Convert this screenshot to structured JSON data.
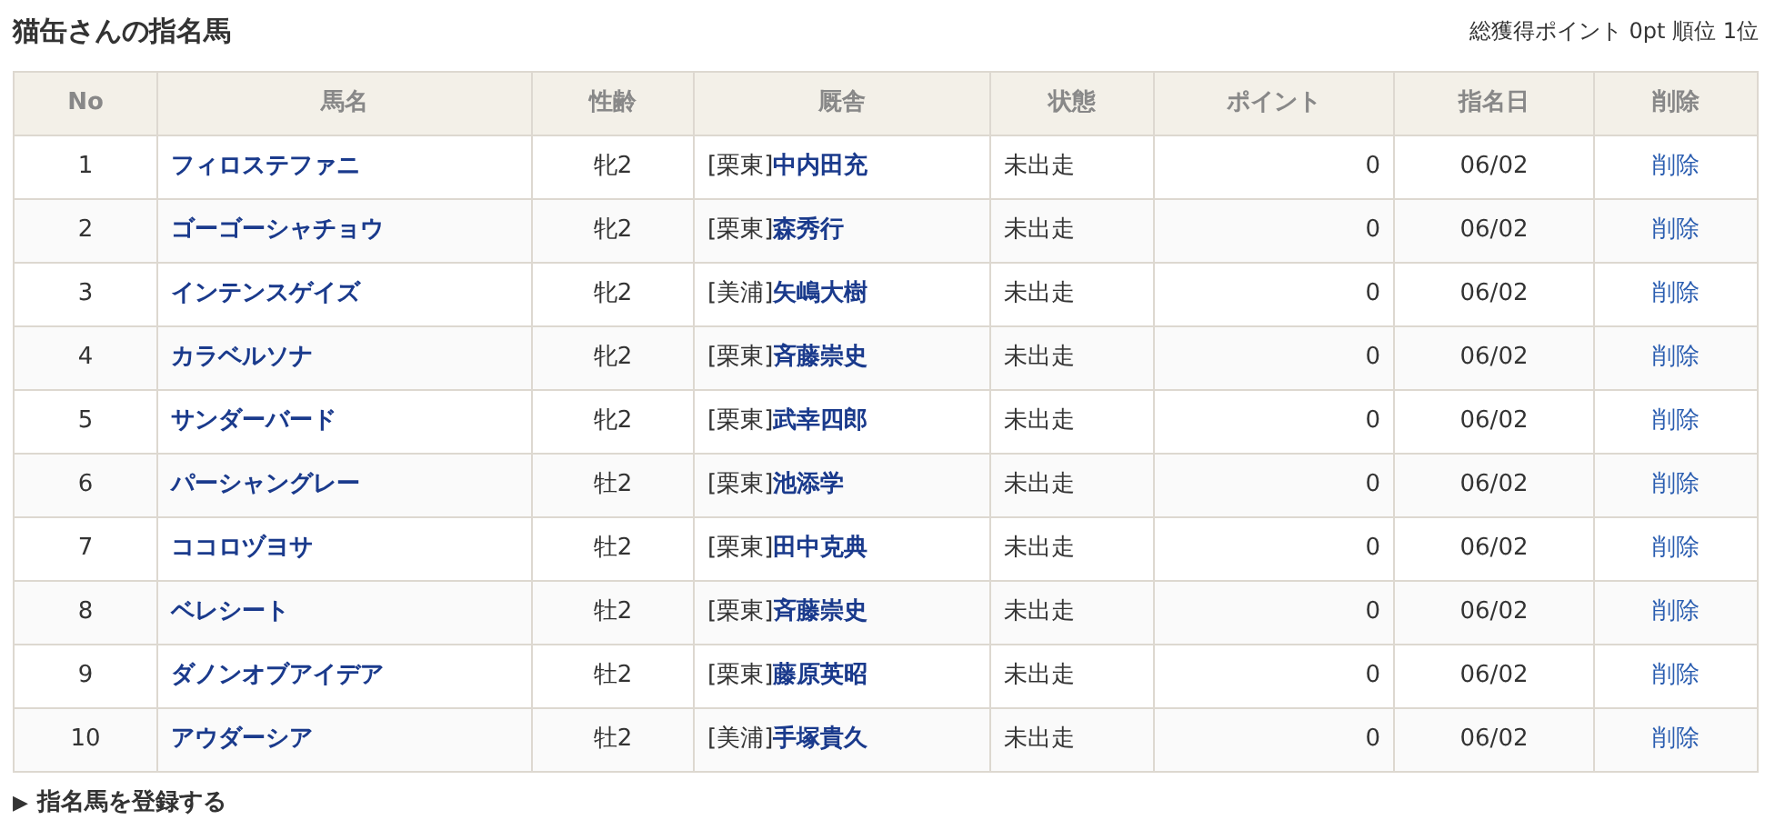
{
  "title": "猫缶さんの指名馬",
  "summary": "総獲得ポイント 0pt 順位 1位",
  "table": {
    "columns": [
      "No",
      "馬名",
      "性齢",
      "厩舎",
      "状態",
      "ポイント",
      "指名日",
      "削除"
    ],
    "rows": [
      {
        "no": "1",
        "horse": "フィロステファニ",
        "sex_age": "牝2",
        "stable": "[栗東]",
        "trainer": "中内田充",
        "status": "未出走",
        "points": "0",
        "date": "06/02",
        "delete": "削除"
      },
      {
        "no": "2",
        "horse": "ゴーゴーシャチョウ",
        "sex_age": "牝2",
        "stable": "[栗東]",
        "trainer": "森秀行",
        "status": "未出走",
        "points": "0",
        "date": "06/02",
        "delete": "削除"
      },
      {
        "no": "3",
        "horse": "インテンスゲイズ",
        "sex_age": "牝2",
        "stable": "[美浦]",
        "trainer": "矢嶋大樹",
        "status": "未出走",
        "points": "0",
        "date": "06/02",
        "delete": "削除"
      },
      {
        "no": "4",
        "horse": "カラベルソナ",
        "sex_age": "牝2",
        "stable": "[栗東]",
        "trainer": "斉藤崇史",
        "status": "未出走",
        "points": "0",
        "date": "06/02",
        "delete": "削除"
      },
      {
        "no": "5",
        "horse": "サンダーバード",
        "sex_age": "牝2",
        "stable": "[栗東]",
        "trainer": "武幸四郎",
        "status": "未出走",
        "points": "0",
        "date": "06/02",
        "delete": "削除"
      },
      {
        "no": "6",
        "horse": "パーシャングレー",
        "sex_age": "牡2",
        "stable": "[栗東]",
        "trainer": "池添学",
        "status": "未出走",
        "points": "0",
        "date": "06/02",
        "delete": "削除"
      },
      {
        "no": "7",
        "horse": "ココロヅヨサ",
        "sex_age": "牡2",
        "stable": "[栗東]",
        "trainer": "田中克典",
        "status": "未出走",
        "points": "0",
        "date": "06/02",
        "delete": "削除"
      },
      {
        "no": "8",
        "horse": "ベレシート",
        "sex_age": "牡2",
        "stable": "[栗東]",
        "trainer": "斉藤崇史",
        "status": "未出走",
        "points": "0",
        "date": "06/02",
        "delete": "削除"
      },
      {
        "no": "9",
        "horse": "ダノンオブアイデア",
        "sex_age": "牡2",
        "stable": "[栗東]",
        "trainer": "藤原英昭",
        "status": "未出走",
        "points": "0",
        "date": "06/02",
        "delete": "削除"
      },
      {
        "no": "10",
        "horse": "アウダーシア",
        "sex_age": "牡2",
        "stable": "[美浦]",
        "trainer": "手塚貴久",
        "status": "未出走",
        "points": "0",
        "date": "06/02",
        "delete": "削除"
      }
    ]
  },
  "register_link": {
    "marker": "▶",
    "label": "指名馬を登録する"
  }
}
